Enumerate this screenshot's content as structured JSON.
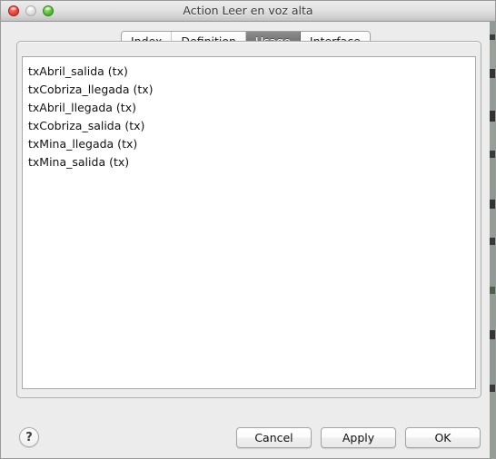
{
  "window": {
    "title": "Action Leer en voz alta",
    "controls": [
      {
        "name": "close-button",
        "icon": "close-traffic-light",
        "state": "enabled"
      },
      {
        "name": "minimize-button",
        "icon": "minimize-traffic-light",
        "state": "disabled"
      },
      {
        "name": "zoom-button",
        "icon": "zoom-traffic-light",
        "state": "enabled"
      }
    ]
  },
  "tabs": [
    {
      "label": "Index",
      "selected": false
    },
    {
      "label": "Definition",
      "selected": false
    },
    {
      "label": "Usage",
      "selected": true
    },
    {
      "label": "Interface",
      "selected": false
    }
  ],
  "usage_list": {
    "items": [
      "txAbril_salida (tx)",
      "txCobriza_llegada (tx)",
      "txAbril_llegada (tx)",
      "txCobriza_salida (tx)",
      "txMina_llegada (tx)",
      "txMina_salida (tx)"
    ]
  },
  "footer": {
    "help_label": "?",
    "buttons": [
      {
        "label": "Cancel"
      },
      {
        "label": "Apply"
      },
      {
        "label": "OK"
      }
    ]
  },
  "colors": {
    "window_background": "#ececec",
    "list_background": "#ffffff",
    "selected_tab_background": "#767676",
    "selected_tab_text": "#ffffff",
    "text": "#111111",
    "border": "#a9a9a9",
    "close_light": "#ef4a3f",
    "minimize_light": "#e0e0e0",
    "zoom_light": "#5fc23c"
  }
}
